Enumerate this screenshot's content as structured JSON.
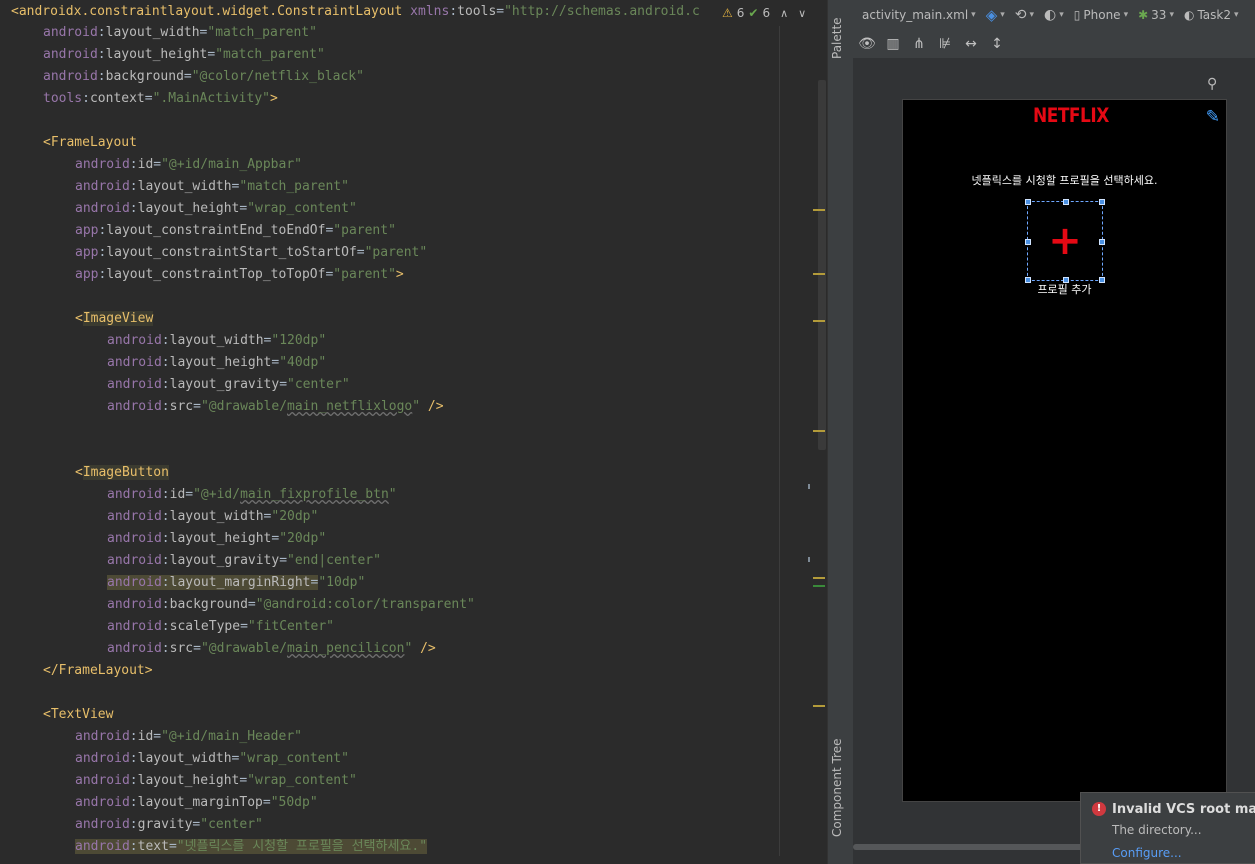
{
  "editor": {
    "header_line": "<androidx.constraintlayout.widget.ConstraintLayout xmlns:tools=\"http://schemas.android.c",
    "warnings_count": "6",
    "checks_count": "6",
    "lines": [
      "android:layout_width=\"match_parent\"",
      "android:layout_height=\"match_parent\"",
      "android:background=\"@color/netflix_black\"",
      "tools:context=\".MainActivity\">",
      "",
      "<FrameLayout",
      "android:id=\"@+id/main_Appbar\"",
      "android:layout_width=\"match_parent\"",
      "android:layout_height=\"wrap_content\"",
      "app:layout_constraintEnd_toEndOf=\"parent\"",
      "app:layout_constraintStart_toStartOf=\"parent\"",
      "app:layout_constraintTop_toTopOf=\"parent\">",
      "",
      "<ImageView",
      "android:layout_width=\"120dp\"",
      "android:layout_height=\"40dp\"",
      "android:layout_gravity=\"center\"",
      "android:src=\"@drawable/main_netflixlogo\" />",
      "",
      "",
      "<ImageButton",
      "android:id=\"@+id/main_fixprofile_btn\"",
      "android:layout_width=\"20dp\"",
      "android:layout_height=\"20dp\"",
      "android:layout_gravity=\"end|center\"",
      "android:layout_marginRight=\"10dp\"",
      "android:background=\"@android:color/transparent\"",
      "android:scaleType=\"fitCenter\"",
      "android:src=\"@drawable/main_pencilicon\" />",
      "</FrameLayout>",
      "",
      "<TextView",
      "android:id=\"@+id/main_Header\"",
      "android:layout_width=\"wrap_content\"",
      "android:layout_height=\"wrap_content\"",
      "android:layout_marginTop=\"50dp\"",
      "android:gravity=\"center\"",
      "android:text=\"넷플릭스를 시청할 프로필을 선택하세요.\""
    ]
  },
  "side_strip": {
    "palette": "Palette",
    "component_tree": "Component Tree"
  },
  "design_toolbar": {
    "file": "activity_main.xml",
    "device": "Phone",
    "api": "33",
    "theme": "Task2"
  },
  "preview": {
    "logo": "NETFLIX",
    "header": "넷플릭스를 시청할 프로필을 선택하세요.",
    "add_profile_label": "프로필 추가"
  },
  "notification": {
    "title": "Invalid VCS root mapping",
    "body": "The directory...",
    "link": "Configure..."
  },
  "colors": {
    "netflix_red": "#e50914",
    "selection_blue": "#4a90e2",
    "link_blue": "#589df6"
  }
}
